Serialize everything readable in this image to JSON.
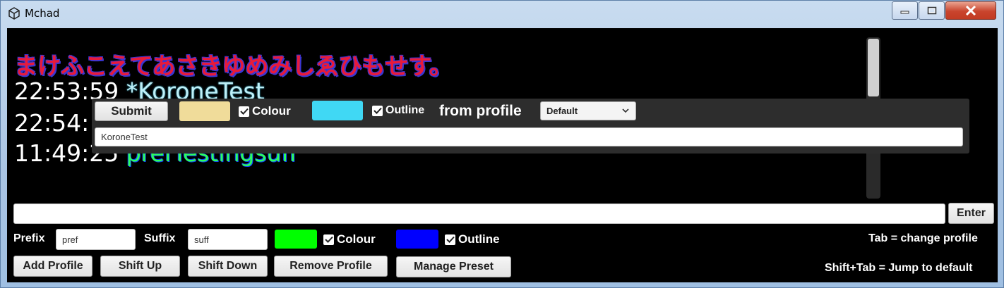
{
  "window": {
    "title": "Mchad"
  },
  "chat": {
    "header_line": "まけふこえてあさきゆめみしゑひもせす。",
    "lines": [
      {
        "time": "22:53:59",
        "name": "*KoroneTest"
      },
      {
        "time": "22:54:",
        "name": ""
      },
      {
        "time": "11:49:25",
        "name": "prefTestingsuff"
      }
    ]
  },
  "popup": {
    "submit_label": "Submit",
    "colour_label": "Colour",
    "outline_label": "Outline",
    "from_profile_label": "from profile",
    "profile_select": "Default",
    "name_value": "KoroneTest",
    "colour_swatch": "#f0dc9a",
    "outline_swatch": "#40d8f4"
  },
  "input": {
    "enter_label": "Enter",
    "value": ""
  },
  "profile": {
    "prefix_label": "Prefix",
    "prefix_value": "pref",
    "suffix_label": "Suffix",
    "suffix_value": "suff",
    "colour_label": "Colour",
    "outline_label": "Outline",
    "colour_swatch": "#00ff00",
    "outline_swatch": "#0000ff"
  },
  "buttons": {
    "add_profile": "Add Profile",
    "shift_up": "Shift Up",
    "shift_down": "Shift Down",
    "remove_profile": "Remove Profile",
    "manage_preset": "Manage Preset"
  },
  "hints": {
    "tab": "Tab = change profile",
    "shift_tab": "Shift+Tab = Jump to default"
  }
}
